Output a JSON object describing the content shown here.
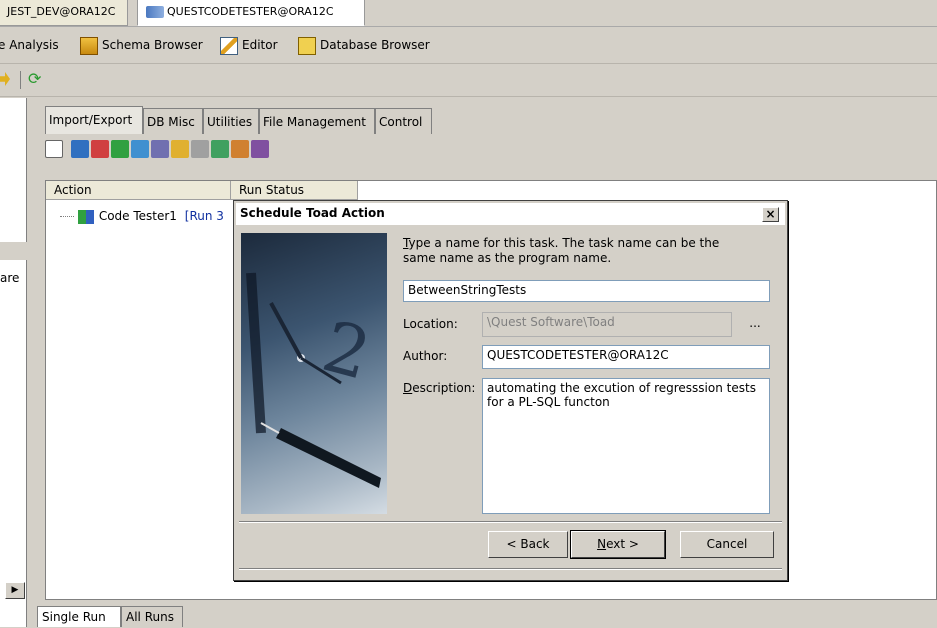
{
  "connections": {
    "tab1": "JEST_DEV@ORA12C",
    "tab2": "QUESTCODETESTER@ORA12C"
  },
  "toolbar": {
    "analysis": "e Analysis",
    "schema_browser": "Schema Browser",
    "editor": "Editor",
    "database_browser": "Database Browser"
  },
  "left_panel": {
    "partial_text": "are"
  },
  "inner_tabs": [
    "Import/Export",
    "DB Misc",
    "Utilities",
    "File Management",
    "Control"
  ],
  "grid": {
    "col_action": "Action",
    "col_run_status": "Run Status",
    "row1_action": "Code Tester1",
    "row1_run": "[Run 3"
  },
  "bottom_tabs": [
    "Single Run",
    "All Runs"
  ],
  "dialog": {
    "title": "Schedule Toad Action",
    "close": "×",
    "instruction_line1": "ype a name for this task.  The task name can be the",
    "instruction_underline": "T",
    "instruction_line2": "same name as the program name.",
    "task_name": "BetweenStringTests",
    "location_label": "Location:",
    "location_value": "\\Quest Software\\Toad",
    "browse": "...",
    "author_label": "Author:",
    "author_value": "QUESTCODETESTER@ORA12C",
    "description_label_u": "D",
    "description_label_rest": "escription:",
    "description_value": "automating the excution of regresssion tests for a PL-SQL functon",
    "back": "< Back",
    "next_u": "N",
    "next_rest": "ext >",
    "cancel": "Cancel"
  },
  "colors": {
    "chrome": "#d4d0c8",
    "selected_tab": "#ffffff"
  }
}
